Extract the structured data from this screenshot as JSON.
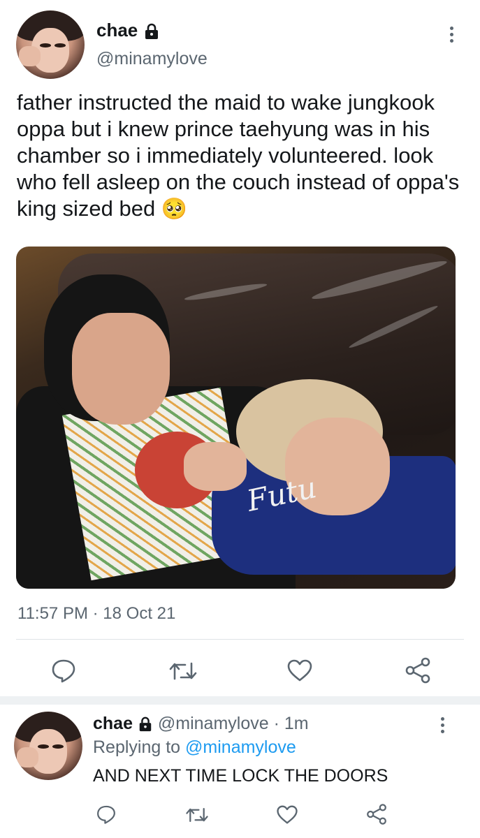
{
  "tweet": {
    "display_name": "chae",
    "handle": "@minamylove",
    "text": "father instructed the maid to wake jungkook oppa but i knew prince taehyung was in his chamber so i immediately volunteered. look who fell asleep on the couch instead of oppa's king sized bed",
    "emoji": "🥺",
    "time": "11:57 PM",
    "separator": "·",
    "date": "18 Oct 21",
    "photo_text": "Futu"
  },
  "reply": {
    "display_name": "chae",
    "handle": "@minamylove",
    "separator": "·",
    "age": "1m",
    "replying_to_label": "Replying to",
    "replying_to_handle": "@minamylove",
    "text": "AND NEXT TIME LOCK THE DOORS"
  },
  "icons": [
    "lock-icon",
    "more-icon",
    "reply-icon",
    "retweet-icon",
    "like-icon",
    "share-icon"
  ],
  "colors": {
    "text": "#14171a",
    "muted": "#5b6670",
    "link": "#1d9bf0",
    "divider": "#dfe3e6"
  }
}
